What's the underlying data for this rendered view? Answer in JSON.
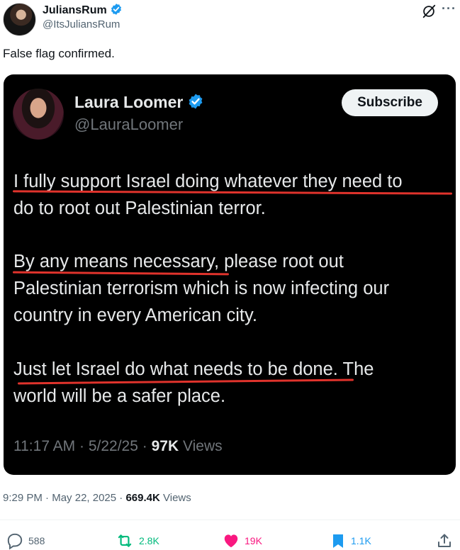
{
  "author": {
    "display_name": "JuliansRum",
    "handle": "@ItsJuliansRum"
  },
  "post_text": "False flag confirmed.",
  "quoted": {
    "display_name": "Laura Loomer",
    "handle": "@LauraLoomer",
    "subscribe_label": "Subscribe",
    "paragraphs": [
      "I fully support Israel doing whatever they need to\ndo to root out Palestinian terror.",
      "By any means necessary, please root out\nPalestinian terrorism which is now infecting our\ncountry in every American city.",
      "Just let Israel do what needs to be done. The\nworld will be a safer place."
    ],
    "time": "11:17 AM",
    "date": "5/22/25",
    "views_count": "97K",
    "views_label": "Views"
  },
  "meta": {
    "time": "9:29 PM",
    "date": "May 22, 2025",
    "views_count": "669.4K",
    "views_label": "Views"
  },
  "actions": {
    "replies": "588",
    "reposts": "2.8K",
    "likes": "19K",
    "bookmarks": "1.1K"
  },
  "colors": {
    "verified": "#1d9bf0",
    "repost": "#00ba7c",
    "like": "#f91880",
    "bookmark": "#1d9bf0",
    "underline": "#e0332c"
  },
  "icons": [
    "verified-badge-icon",
    "grok-icon",
    "more-icon",
    "reply-icon",
    "repost-icon",
    "like-icon",
    "bookmark-icon",
    "share-icon"
  ]
}
